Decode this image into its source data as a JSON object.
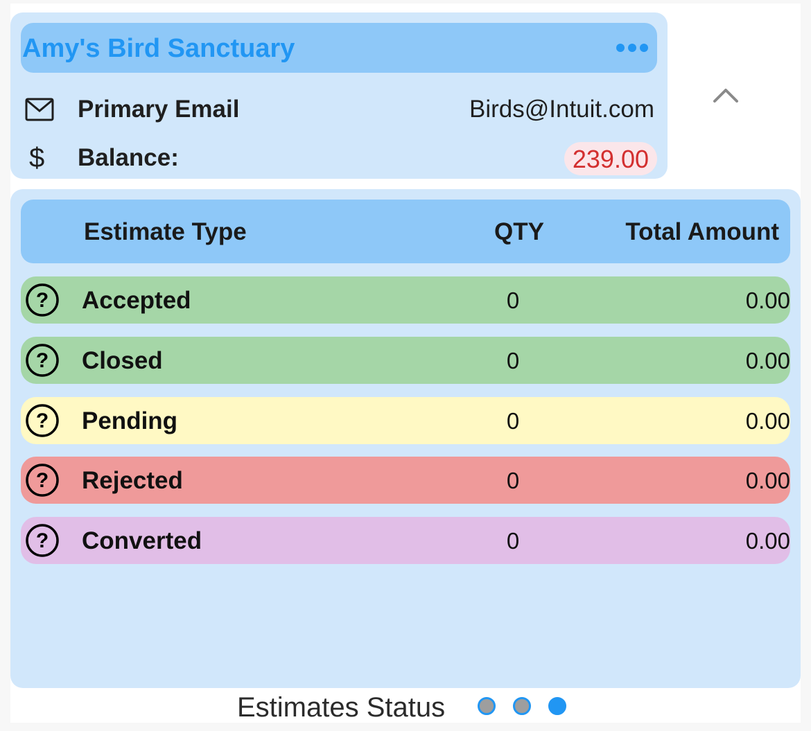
{
  "customer": {
    "name": "Amy's Bird Sanctuary",
    "email_label": "Primary Email",
    "email_value": "Birds@Intuit.com",
    "balance_label": "Balance:",
    "balance_value": "239.00",
    "dollar_symbol": "$",
    "icons": {
      "menu": "more-horizontal-icon",
      "email": "envelope-icon",
      "balance": "dollar-icon",
      "collapse": "chevron-up-icon"
    }
  },
  "estimates": {
    "headers": {
      "type": "Estimate Type",
      "qty": "QTY",
      "total": "Total Amount"
    },
    "rows": [
      {
        "label": "Accepted",
        "qty": "0",
        "total": "0.00",
        "color": "#a5d6a7",
        "icon": "question-circle-icon"
      },
      {
        "label": "Closed",
        "qty": "0",
        "total": "0.00",
        "color": "#a5d6a7",
        "icon": "question-circle-icon"
      },
      {
        "label": "Pending",
        "qty": "0",
        "total": "0.00",
        "color": "#fff9c4",
        "icon": "question-circle-icon"
      },
      {
        "label": "Rejected",
        "qty": "0",
        "total": "0.00",
        "color": "#ef9a9a",
        "icon": "question-circle-icon"
      },
      {
        "label": "Converted",
        "qty": "0",
        "total": "0.00",
        "color": "#e1bee7",
        "icon": "question-circle-icon"
      }
    ]
  },
  "footer": {
    "label": "Estimates Status",
    "pager": {
      "page_count": 3,
      "active_page": 3,
      "inactive_color": "#9e9e9e",
      "active_color": "#2196f3"
    }
  },
  "colors": {
    "card_background": "#d1e7fb",
    "header_background": "#8ec8f8",
    "title_color": "#2196f3",
    "balance_text": "#d32f2f",
    "balance_pill": "#fbe6ea"
  }
}
